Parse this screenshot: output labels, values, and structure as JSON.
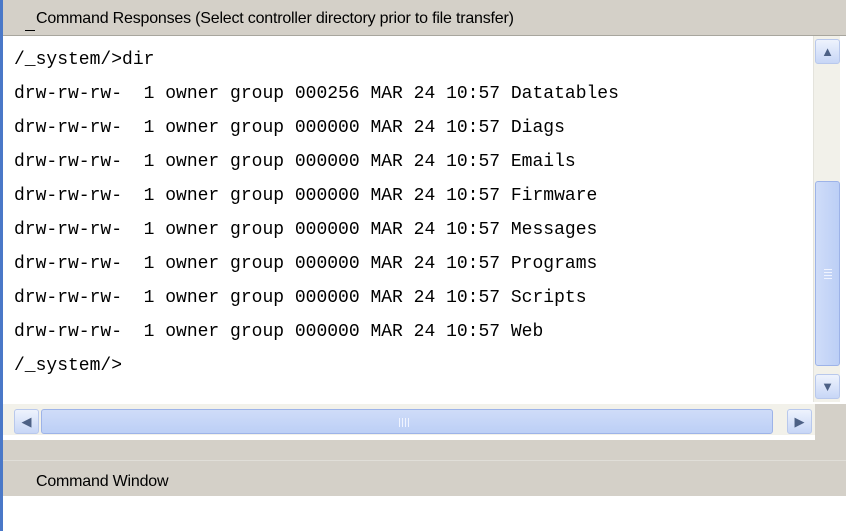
{
  "responses": {
    "title": "Command Responses (Select controller directory prior to file transfer)",
    "lines": [
      "/_system/>dir",
      "drw-rw-rw-  1 owner group 000256 MAR 24 10:57 Datatables",
      "drw-rw-rw-  1 owner group 000000 MAR 24 10:57 Diags",
      "drw-rw-rw-  1 owner group 000000 MAR 24 10:57 Emails",
      "drw-rw-rw-  1 owner group 000000 MAR 24 10:57 Firmware",
      "drw-rw-rw-  1 owner group 000000 MAR 24 10:57 Messages",
      "drw-rw-rw-  1 owner group 000000 MAR 24 10:57 Programs",
      "drw-rw-rw-  1 owner group 000000 MAR 24 10:57 Scripts",
      "drw-rw-rw-  1 owner group 000000 MAR 24 10:57 Web",
      "/_system/>"
    ]
  },
  "scrollbars": {
    "up_icon": "arrow-up-icon",
    "down_icon": "arrow-down-icon",
    "left_icon": "arrow-left-icon",
    "right_icon": "arrow-right-icon",
    "accent": "#c1d3fb"
  },
  "command": {
    "title": "Command Window",
    "value": ""
  }
}
